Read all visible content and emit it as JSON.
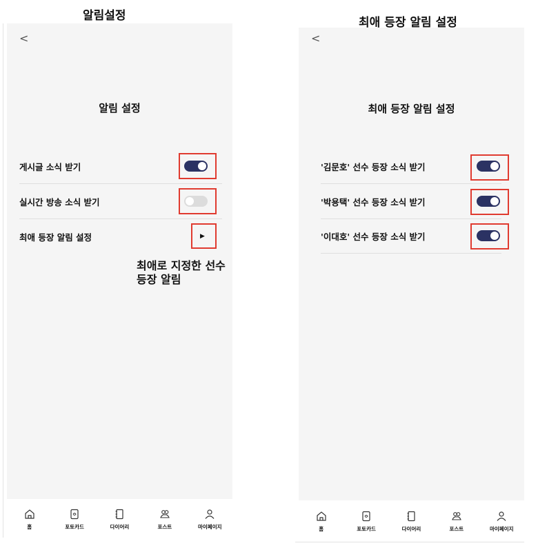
{
  "left_caption": "알림설정",
  "right_caption": "최애 등장 알림 설정",
  "left_screen": {
    "back_glyph": "<",
    "title": "알림 설정",
    "rows": [
      {
        "label": "게시글 소식 받기",
        "control": "toggle",
        "state": "on"
      },
      {
        "label": "실시간 방송 소식 받기",
        "control": "toggle",
        "state": "off"
      },
      {
        "label": "최애 등장 알림 설정",
        "control": "arrow",
        "glyph": "▶"
      }
    ]
  },
  "right_screen": {
    "back_glyph": "<",
    "title": "최애 등장 알림 설정",
    "rows": [
      {
        "label": "'김문호' 선수 등장 소식 받기",
        "control": "toggle",
        "state": "on"
      },
      {
        "label": "'박용택' 선수 등장 소식 받기",
        "control": "toggle",
        "state": "on"
      },
      {
        "label": "'이대호' 선수 등장 소식 받기",
        "control": "toggle",
        "state": "on"
      }
    ]
  },
  "annotation": {
    "line1": "최애로 지정한 선수",
    "line2": "등장 알림"
  },
  "tabbar": {
    "tabs": [
      {
        "label": "홈",
        "icon": "home-icon"
      },
      {
        "label": "포토카드",
        "icon": "photocard-icon"
      },
      {
        "label": "다이어리",
        "icon": "diary-icon"
      },
      {
        "label": "포스트",
        "icon": "post-icon"
      },
      {
        "label": "마이페이지",
        "icon": "person-icon"
      }
    ]
  },
  "colors": {
    "toggle_on": "#2b3263",
    "toggle_off": "#dcdcdc",
    "highlight": "#e03a2f",
    "screen_bg": "#f5f5f5"
  }
}
